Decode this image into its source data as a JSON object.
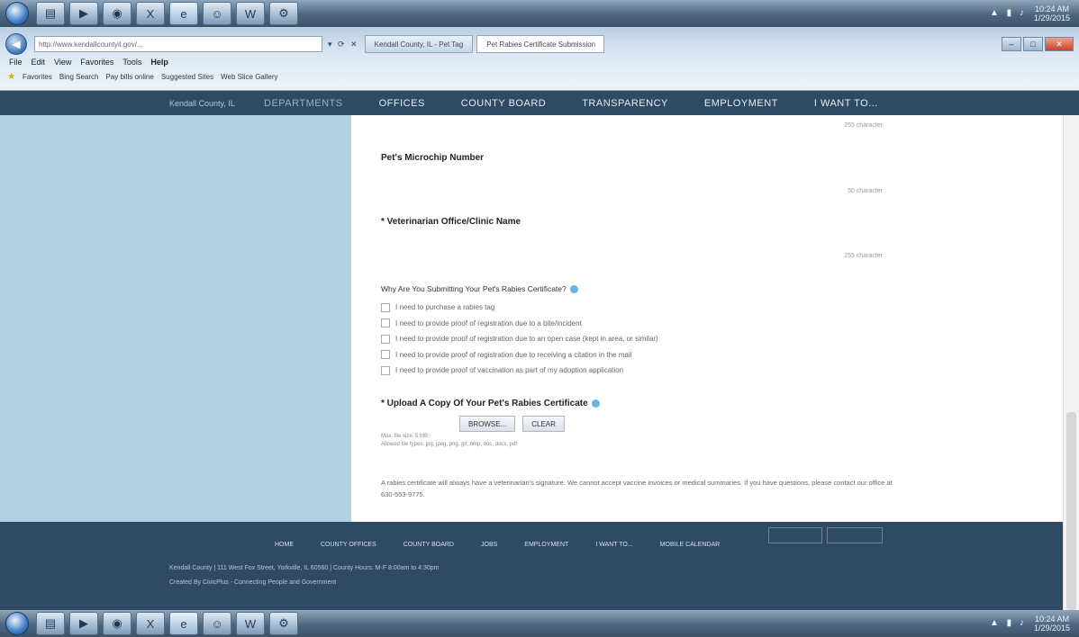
{
  "taskbar": {
    "icons": [
      "start-orb",
      "explorer-icon",
      "media-icon",
      "chrome-icon",
      "excel-icon",
      "ie-icon",
      "people-icon",
      "word-icon",
      "tools-icon"
    ],
    "clock_time": "10:24 AM",
    "clock_date": "1/29/2015"
  },
  "browser": {
    "address": "http://www.kendallcountyil.gov/...",
    "tabs": [
      "Kendall County, IL - Pet Tag",
      "Pet Rabies Certificate Submission"
    ],
    "menu": [
      "File",
      "Edit",
      "View",
      "Favorites",
      "Tools",
      "Help"
    ],
    "favorites": [
      "Favorites",
      "Bing Search",
      "Pay bills online",
      "Suggested Sites",
      "Web Slice Gallery"
    ]
  },
  "site_nav": {
    "brand": "Kendall County, IL",
    "items": [
      "DEPARTMENTS",
      "OFFICES",
      "COUNTY BOARD",
      "TRANSPARENCY",
      "EMPLOYMENT",
      "I WANT TO..."
    ]
  },
  "form": {
    "top_char_count": "255 character",
    "microchip_label": "Pet's Microchip Number",
    "microchip_count": "50 character",
    "vet_label": "* Veterinarian Office/Clinic Name",
    "vet_count": "255 character",
    "question": "Why Are You Submitting Your Pet's Rabies Certificate?",
    "options": [
      "I need to purchase a rabies tag",
      "I need to provide proof of registration due to a bite/incident",
      "I need to provide proof of registration due to an open case (kept in area, or similar)",
      "I need to provide proof of registration due to receiving a citation in the mail",
      "I need to provide proof of vaccination as part of my adoption application"
    ],
    "upload_label": "* Upload A Copy Of Your Pet's Rabies Certificate",
    "browse_label": "BROWSE...",
    "clear_label": "CLEAR",
    "file_note_1": "Max. file size: 5 MB",
    "file_note_2": "Allowed file types: jpg, jpeg, png, gif, bmp, doc, docx, pdf",
    "disclaimer": "A rabies certificate will always have a veterinarian's signature. We cannot accept vaccine invoices or medical summaries. If you have questions, please contact our office at 630-553-9775."
  },
  "footer": {
    "links": [
      "HOME",
      "COUNTY OFFICES",
      "COUNTY BOARD",
      "JOBS",
      "EMPLOYMENT",
      "I WANT TO...",
      "MOBILE CALENDAR"
    ],
    "address": "Kendall County  |  111 West Fox Street, Yorkville, IL 60560  |  County Hours: M-F 8:00am to 4:30pm",
    "credit": "Created By CivicPlus - Connecting People and Government"
  }
}
